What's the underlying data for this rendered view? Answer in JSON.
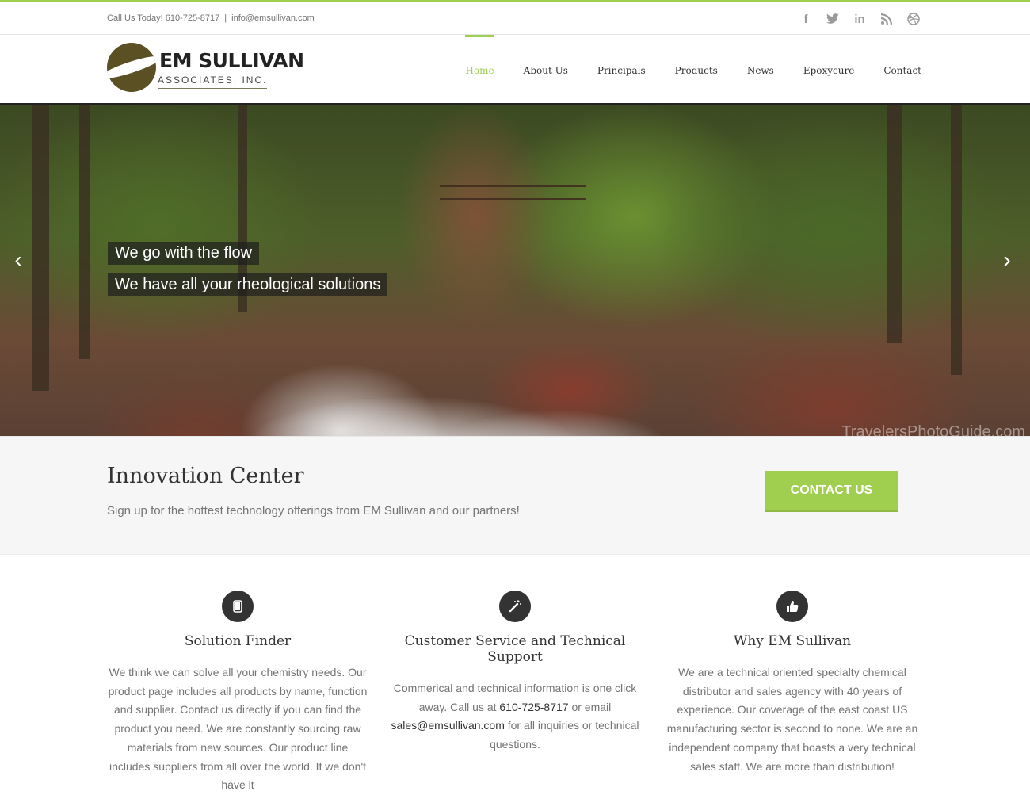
{
  "topbar": {
    "phone_text": "Call Us Today! 610-725-8717",
    "separator": "|",
    "email_text": "info@emsullivan.com",
    "social": [
      {
        "icon": "facebook-icon",
        "glyph": "f"
      },
      {
        "icon": "twitter-icon",
        "glyph": "🐦"
      },
      {
        "icon": "linkedin-icon",
        "glyph": "in"
      },
      {
        "icon": "rss-icon",
        "glyph": "⟟"
      },
      {
        "icon": "dribbble-icon",
        "glyph": "⊛"
      }
    ]
  },
  "logo": {
    "line1": "EM SULLIVAN",
    "line2": "ASSOCIATES, INC."
  },
  "nav": {
    "items": [
      "Home",
      "About Us",
      "Principals",
      "Products",
      "News",
      "Epoxycure",
      "Contact"
    ],
    "active": "Home"
  },
  "hero": {
    "caption1": "We go with the flow",
    "caption2": "We have all your rheological solutions",
    "watermark": "TravelersPhotoGuide.com",
    "prev_glyph": "‹",
    "next_glyph": "›"
  },
  "innovation": {
    "title": "Innovation Center",
    "subtitle": "Sign up for the hottest technology offerings from EM Sullivan and our partners!",
    "cta_label": "CONTACT US"
  },
  "features": [
    {
      "icon": "tablet-icon",
      "title": "Solution Finder",
      "text": "We think we can solve all your chemistry needs. Our product page includes all products by name, function and supplier. Contact us directly if you can find the product you need. We are constantly sourcing raw materials from new sources. Our product line includes suppliers from all over the world. If we don't have it"
    },
    {
      "icon": "magic-wand-icon",
      "title": "Customer Service and Technical Support",
      "text_before": "Commerical and technical information is one click away. Call us at ",
      "phone": "610-725-8717",
      "text_middle": " or email ",
      "email": "sales@emsullivan.com",
      "text_after": " for all inquiries or technical questions."
    },
    {
      "icon": "thumbs-up-icon",
      "title": "Why EM Sullivan",
      "text": "We are a technical oriented specialty chemical distributor and sales agency with 40 years of experience. Our coverage of the east coast US manufacturing sector is second to none. We are an independent company that boasts a very technical sales staff. We are more than distribution!"
    }
  ],
  "colors": {
    "accent": "#a0ce4e",
    "text": "#747474",
    "heading": "#333333"
  }
}
